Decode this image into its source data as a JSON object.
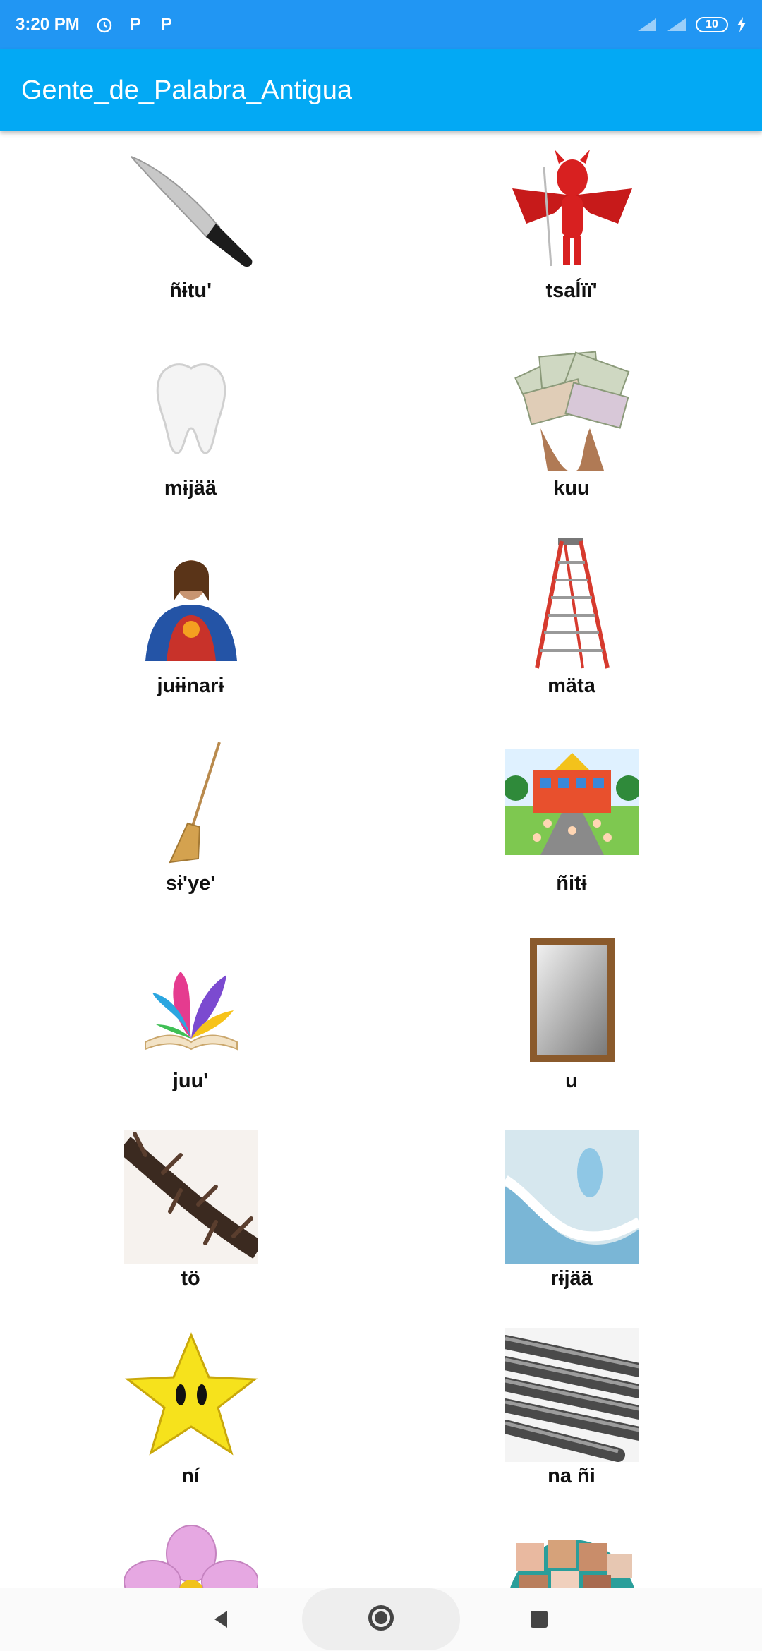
{
  "status_bar": {
    "time": "3:20 PM",
    "icons": [
      "alarm-icon",
      "p-icon",
      "p-icon"
    ],
    "battery": "10"
  },
  "app_bar": {
    "title": "Gente_de_Palabra_Antigua"
  },
  "items": [
    {
      "label": "ñɨtu'",
      "icon": "knife-icon"
    },
    {
      "label": "tsaĺïï'",
      "icon": "devil-icon"
    },
    {
      "label": "mɨjää",
      "icon": "tooth-icon"
    },
    {
      "label": "kuu",
      "icon": "money-icon"
    },
    {
      "label": "juɨɨnarɨ",
      "icon": "jesus-icon"
    },
    {
      "label": "mäta",
      "icon": "ladder-icon"
    },
    {
      "label": "sɨ'ye'",
      "icon": "broom-icon"
    },
    {
      "label": "ñitɨ",
      "icon": "school-icon"
    },
    {
      "label": "juu'",
      "icon": "book-icon"
    },
    {
      "label": "u",
      "icon": "mirror-icon"
    },
    {
      "label": "tö",
      "icon": "thorn-branch-icon"
    },
    {
      "label": "rɨjää",
      "icon": "foam-icon"
    },
    {
      "label": "ní",
      "icon": "star-icon"
    },
    {
      "label": "na ñi",
      "icon": "steel-bars-icon"
    },
    {
      "label": "",
      "icon": "flower-icon"
    },
    {
      "label": "",
      "icon": "photo-collage-icon"
    }
  ],
  "nav_bar": {
    "icons": [
      "back-icon",
      "home-icon",
      "recents-icon"
    ]
  }
}
